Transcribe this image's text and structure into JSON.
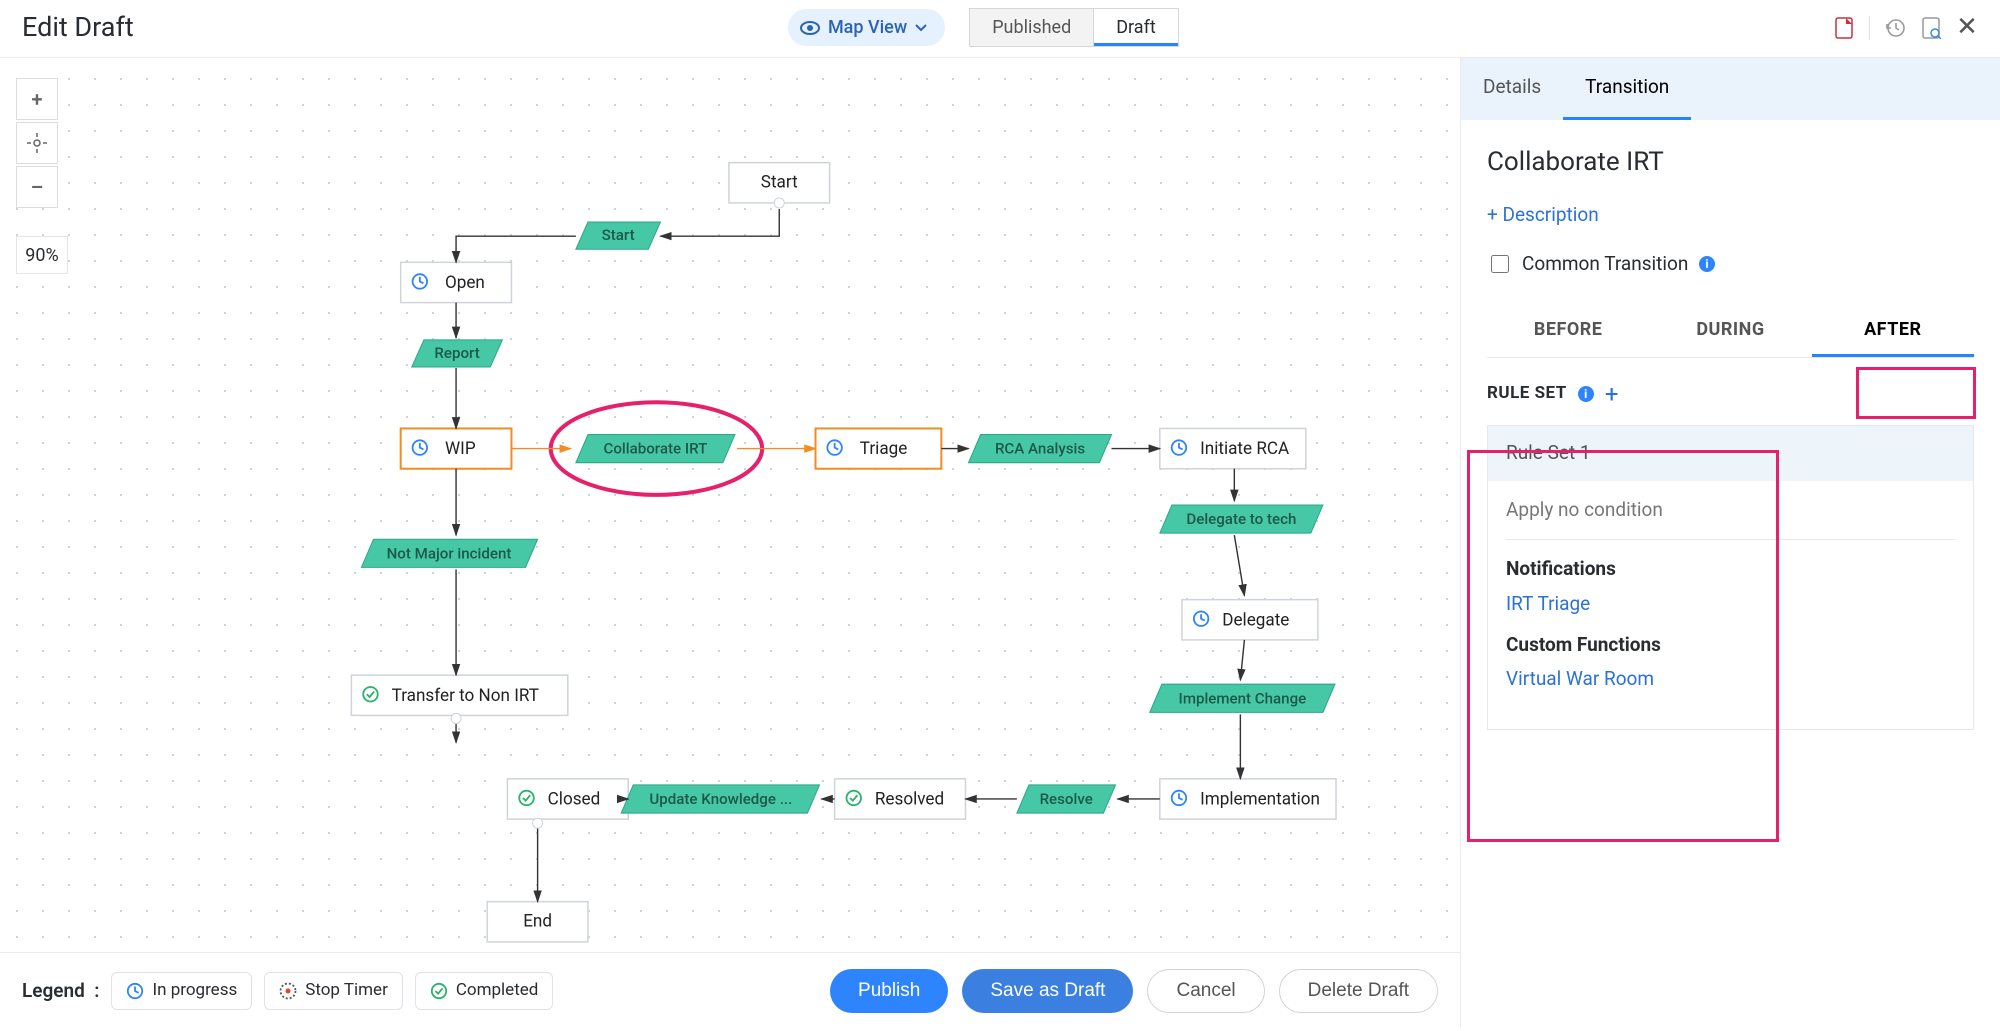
{
  "header": {
    "title": "Edit Draft",
    "view_label": "Map View",
    "tabs": [
      "Published",
      "Draft"
    ],
    "active_tab": "Draft"
  },
  "zoom": {
    "pct": "90%"
  },
  "nodes": {
    "start": "Start",
    "open": "Open",
    "wip": "WIP",
    "triage": "Triage",
    "initiate_rca": "Initiate RCA",
    "delegate": "Delegate",
    "implementation": "Implementation",
    "resolved": "Resolved",
    "closed": "Closed",
    "end": "End",
    "xfer": "Transfer to Non IRT"
  },
  "transitions": {
    "start": "Start",
    "report": "Report",
    "collab": "Collaborate IRT",
    "rca": "RCA Analysis",
    "not_major": "Not Major incident",
    "delegate_tech": "Delegate to tech",
    "impl_change": "Implement Change",
    "resolve": "Resolve",
    "update_know": "Update Knowledge ..."
  },
  "legend": {
    "label": "Legend",
    "items": [
      "In progress",
      "Stop Timer",
      "Completed"
    ]
  },
  "footer": {
    "publish": "Publish",
    "save": "Save as Draft",
    "cancel": "Cancel",
    "delete": "Delete Draft"
  },
  "side": {
    "tabs": [
      "Details",
      "Transition"
    ],
    "active": "Transition",
    "title": "Collaborate IRT",
    "desc_link": "+ Description",
    "common": "Common Transition",
    "stage_tabs": [
      "BEFORE",
      "DURING",
      "AFTER"
    ],
    "active_stage": "AFTER",
    "ruleset_hdr": "RULE SET",
    "rule": {
      "name": "Rule Set 1",
      "cond": "Apply no condition",
      "notif_hdr": "Notifications",
      "notif_link": "IRT Triage",
      "fn_hdr": "Custom Functions",
      "fn_link": "Virtual War Room"
    }
  }
}
